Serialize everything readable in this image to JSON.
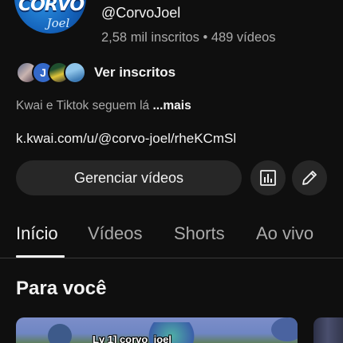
{
  "channel": {
    "avatar_logo_line1": "CORVO",
    "avatar_logo_line2": "Joel",
    "handle": "@CorvoJoel",
    "stats": "2,58 mil inscritos • 489 vídeos"
  },
  "subscribers": {
    "avatar_letter": "J",
    "label": "Ver inscritos"
  },
  "description": {
    "text": "Kwai e Tiktok seguem lá ",
    "more": "...mais"
  },
  "link": "k.kwai.com/u/@corvo-joel/rheKCmSl",
  "actions": {
    "manage_videos": "Gerenciar vídeos",
    "stats_icon": "analytics-icon",
    "edit_icon": "pencil-icon"
  },
  "tabs": [
    {
      "label": "Início",
      "active": true
    },
    {
      "label": "Vídeos",
      "active": false
    },
    {
      "label": "Shorts",
      "active": false
    },
    {
      "label": "Ao vivo",
      "active": false
    }
  ],
  "section": {
    "title": "Para você"
  },
  "video": {
    "thumbnail_text": "Lv 1] corvo_joel"
  }
}
